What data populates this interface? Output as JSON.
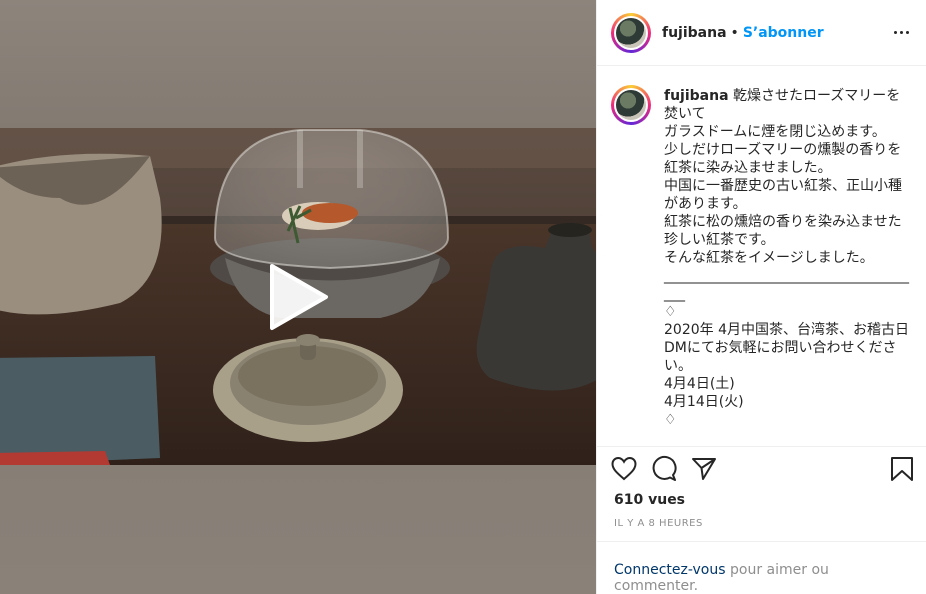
{
  "post": {
    "username": "fujibana",
    "separator": "•",
    "follow_label": "S’abonner",
    "caption_user": "fujibana",
    "caption": " 乾燥させたローズマリーを焚いて\nガラスドームに煙を閉じ込めます。\n少しだけローズマリーの燻製の香りを紅茶に染み込ませました。\n中国に一番歴史の古い紅茶、正山小種があります。\n紅茶に松の燻焙の香りを染み込ませた珍しい紅茶です。\nそんな紅茶をイメージしました。\n______________________________________\n♢\n2020年 4月中国茶、台湾茶、お稽古日\nDMにてお気軽にお問い合わせください。\n4月4日(土)\n4月14日(火)\n♢",
    "views": "610 vues",
    "timestamp": "IL Y A 8 HEURES"
  },
  "footer": {
    "login_link": "Connectez-vous",
    "login_rest": " pour aimer ou commenter."
  },
  "icons": {
    "more": "more-options-icon",
    "like": "heart-icon",
    "comment": "comment-icon",
    "share": "share-icon",
    "save": "bookmark-icon",
    "play": "play-icon"
  },
  "colors": {
    "accent": "#0095f6",
    "link": "#00376b",
    "muted": "#8e8e8e",
    "text": "#262626"
  }
}
